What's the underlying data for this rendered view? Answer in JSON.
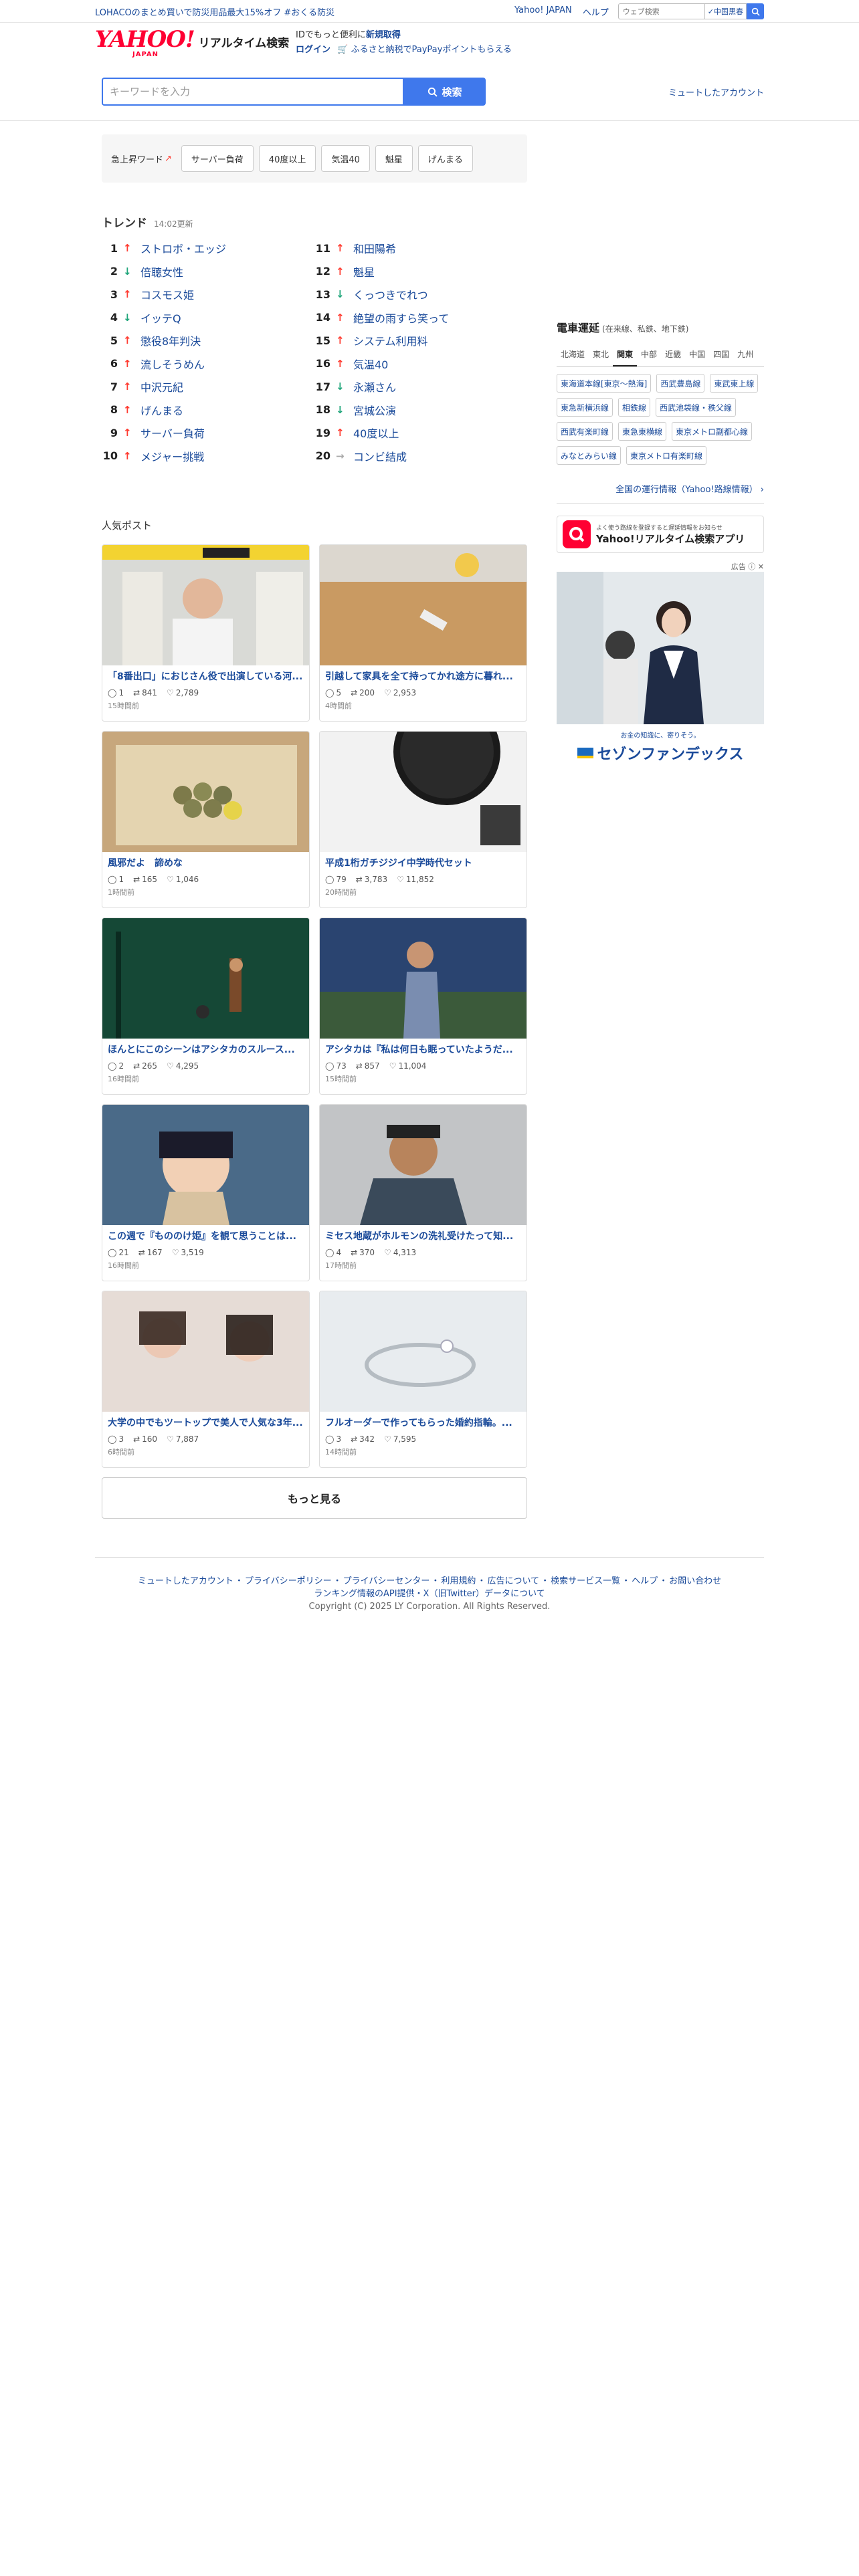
{
  "topbar": {
    "promo": "LOHACOのまとめ買いで防災用品最大15%オフ #おくる防災",
    "links": [
      "Yahoo! JAPAN",
      "ヘルプ"
    ],
    "search_placeholder": "ウェブ検索",
    "search_option": "中国黒春"
  },
  "header": {
    "logo_text": "YAHOO!",
    "logo_sub": "JAPAN",
    "title": "リアルタイム検索",
    "info_line1_prefix": "IDでもっと便利に",
    "info_line1_link": "新規取得",
    "login": "ログイン",
    "info_line2": "ふるさと納税でPayPayポイントもらえる"
  },
  "search": {
    "placeholder": "キーワードを入力",
    "button": "検索",
    "muted_accounts": "ミュートしたアカウント"
  },
  "rising": {
    "label": "急上昇ワード",
    "chips": [
      "サーバー負荷",
      "40度以上",
      "気温40",
      "魁星",
      "げんまる"
    ]
  },
  "trend": {
    "title": "トレンド",
    "updated": "14:02更新",
    "items": [
      {
        "rank": "1",
        "dir": "up",
        "word": "ストロボ・エッジ"
      },
      {
        "rank": "2",
        "dir": "down",
        "word": "倍聴女性"
      },
      {
        "rank": "3",
        "dir": "up",
        "word": "コスモス姫"
      },
      {
        "rank": "4",
        "dir": "down",
        "word": "イッテQ"
      },
      {
        "rank": "5",
        "dir": "up",
        "word": "懲役8年判決"
      },
      {
        "rank": "6",
        "dir": "up",
        "word": "流しそうめん"
      },
      {
        "rank": "7",
        "dir": "up",
        "word": "中沢元紀"
      },
      {
        "rank": "8",
        "dir": "up",
        "word": "げんまる"
      },
      {
        "rank": "9",
        "dir": "up",
        "word": "サーバー負荷"
      },
      {
        "rank": "10",
        "dir": "up",
        "word": "メジャー挑戦"
      },
      {
        "rank": "11",
        "dir": "up",
        "word": "和田陽希"
      },
      {
        "rank": "12",
        "dir": "up",
        "word": "魁星"
      },
      {
        "rank": "13",
        "dir": "down",
        "word": "くっつきでれつ"
      },
      {
        "rank": "14",
        "dir": "up",
        "word": "絶望の雨すら笑って"
      },
      {
        "rank": "15",
        "dir": "up",
        "word": "システム利用料"
      },
      {
        "rank": "16",
        "dir": "up",
        "word": "気温40"
      },
      {
        "rank": "17",
        "dir": "down",
        "word": "永瀬さん"
      },
      {
        "rank": "18",
        "dir": "down",
        "word": "宮城公演"
      },
      {
        "rank": "19",
        "dir": "up",
        "word": "40度以上"
      },
      {
        "rank": "20",
        "dir": "stay",
        "word": "コンビ結成"
      }
    ]
  },
  "popular": {
    "title": "人気ポスト",
    "more": "もっと見る",
    "posts": [
      {
        "title": "「8番出口」におじさん役で出演している河...",
        "replies": "1",
        "reposts": "841",
        "likes": "2,789",
        "time": "15時間前"
      },
      {
        "title": "引越して家具を全て持ってかれ途方に暮れ...",
        "replies": "5",
        "reposts": "200",
        "likes": "2,953",
        "time": "4時間前"
      },
      {
        "title": "風邪だよ　諦めな",
        "replies": "1",
        "reposts": "165",
        "likes": "1,046",
        "time": "1時間前"
      },
      {
        "title": "平成1桁ガチジジイ中学時代セット",
        "replies": "79",
        "reposts": "3,783",
        "likes": "11,852",
        "time": "20時間前"
      },
      {
        "title": "ほんとにこのシーンはアシタカのスルース...",
        "replies": "2",
        "reposts": "265",
        "likes": "4,295",
        "time": "16時間前"
      },
      {
        "title": "アシタカは『私は何日も眠っていたようだ...",
        "replies": "73",
        "reposts": "857",
        "likes": "11,004",
        "time": "15時間前"
      },
      {
        "title": "この週で『もののけ姫』を観て思うことは...",
        "replies": "21",
        "reposts": "167",
        "likes": "3,519",
        "time": "16時間前"
      },
      {
        "title": "ミセス地蔵がホルモンの洗礼受けたって知...",
        "replies": "4",
        "reposts": "370",
        "likes": "4,313",
        "time": "17時間前"
      },
      {
        "title": "大学の中でもツートップで美人で人気な3年...",
        "replies": "3",
        "reposts": "160",
        "likes": "7,887",
        "time": "6時間前"
      },
      {
        "title": "フルオーダーで作ってもらった婚約指輪。...",
        "replies": "3",
        "reposts": "342",
        "likes": "7,595",
        "time": "14時間前"
      }
    ]
  },
  "sidebar": {
    "train_title": "電車運延",
    "train_sub": "(在来線、私鉄、地下鉄)",
    "regions": [
      "北海道",
      "東北",
      "関東",
      "中部",
      "近畿",
      "中国",
      "四国",
      "九州"
    ],
    "active_region": "関東",
    "lines": [
      "東海道本線[東京〜熱海]",
      "西武豊島線",
      "東武東上線",
      "東急新横浜線",
      "相鉄線",
      "西武池袋線・秩父線",
      "西武有楽町線",
      "東急東横線",
      "東京メトロ副都心線",
      "みなとみらい線",
      "東京メトロ有楽町線"
    ],
    "train_all": "全国の運行情報（Yahoo!路線情報）",
    "app_small": "よく使う路線を登録すると遅延情報をお知らせ",
    "app_name": "Yahoo!リアルタイム検索アプリ",
    "ad_label": "広告",
    "ad_tagline": "お金の知識に、寄りそう。",
    "ad_brand": "セゾンファンデックス"
  },
  "footer": {
    "line1": [
      "ミュートしたアカウント",
      "プライバシーポリシー",
      "プライバシーセンター",
      "利用規約",
      "広告について",
      "検索サービス一覧",
      "ヘルプ",
      "お問い合わせ"
    ],
    "line2": "ランキング情報のAPI提供・X（旧Twitter）データについて",
    "copyright": "Copyright (C) 2025 LY Corporation. All Rights Reserved."
  },
  "colors": {
    "brand": "#ff0033",
    "accent": "#3f78ec",
    "link": "#1a4a9a",
    "up": "#ff3b30",
    "down": "#1fa57a"
  }
}
